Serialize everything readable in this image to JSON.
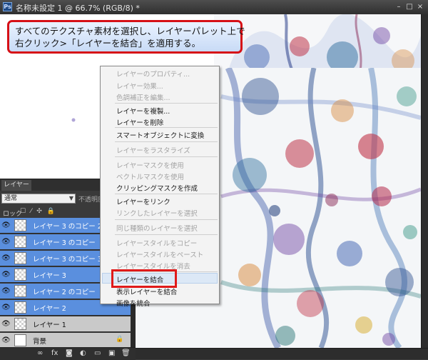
{
  "window": {
    "title": "名称未設定 1 @ 66.7% (RGB/8) *",
    "app_icon": "Ps",
    "controls": {
      "minimize": "–",
      "maximize": "□",
      "close": "×"
    }
  },
  "callout": {
    "line1": "すべてのテクスチャ素材を選択し、レイヤーパレット上で",
    "line2": "右クリック>「レイヤーを結合」を適用する。"
  },
  "context_menu": {
    "items": [
      {
        "label": "レイヤーのプロパティ...",
        "enabled": false
      },
      {
        "label": "レイヤー効果...",
        "enabled": false
      },
      {
        "label": "色調補正を編集...",
        "enabled": false
      },
      {
        "label": "レイヤーを複製...",
        "enabled": true
      },
      {
        "label": "レイヤーを削除",
        "enabled": true
      },
      {
        "label": "スマートオブジェクトに変換",
        "enabled": true
      },
      {
        "label": "レイヤーをラスタライズ",
        "enabled": false
      },
      {
        "label": "レイヤーマスクを使用",
        "enabled": false
      },
      {
        "label": "ベクトルマスクを使用",
        "enabled": false
      },
      {
        "label": "クリッピングマスクを作成",
        "enabled": true
      },
      {
        "label": "レイヤーをリンク",
        "enabled": true
      },
      {
        "label": "リンクしたレイヤーを選択",
        "enabled": false
      },
      {
        "label": "同じ種類のレイヤーを選択",
        "enabled": false
      },
      {
        "label": "レイヤースタイルをコピー",
        "enabled": false
      },
      {
        "label": "レイヤースタイルをペースト",
        "enabled": false
      },
      {
        "label": "レイヤースタイルを消去",
        "enabled": false
      },
      {
        "label": "レイヤーを結合",
        "enabled": true,
        "highlighted": true
      },
      {
        "label": "表示レイヤーを結合",
        "enabled": true
      },
      {
        "label": "画像を統合",
        "enabled": true
      }
    ]
  },
  "layers_panel": {
    "tab": "レイヤー",
    "blend_mode": "通常",
    "opacity_label": "不透明度",
    "lock_label": "ロック",
    "lock_icons": "☐ ⁄ ✣ 🔒",
    "eye_glyph": "👁",
    "lock_glyph": "🔒",
    "layers": [
      {
        "name": "レイヤー 3 のコピー 2",
        "selected": true
      },
      {
        "name": "レイヤー 3 のコピー",
        "selected": true
      },
      {
        "name": "レイヤー 3 のコピー 3",
        "selected": true
      },
      {
        "name": "レイヤー 3",
        "selected": true
      },
      {
        "name": "レイヤー 2 のコピー",
        "selected": true
      },
      {
        "name": "レイヤー 2",
        "selected": true
      },
      {
        "name": "レイヤー 1",
        "selected": false
      },
      {
        "name": "背景",
        "selected": false,
        "locked": true
      }
    ],
    "bottom_buttons": [
      "∞",
      "fx",
      "◙",
      "◐",
      "▭",
      "▣",
      "🗑"
    ]
  }
}
